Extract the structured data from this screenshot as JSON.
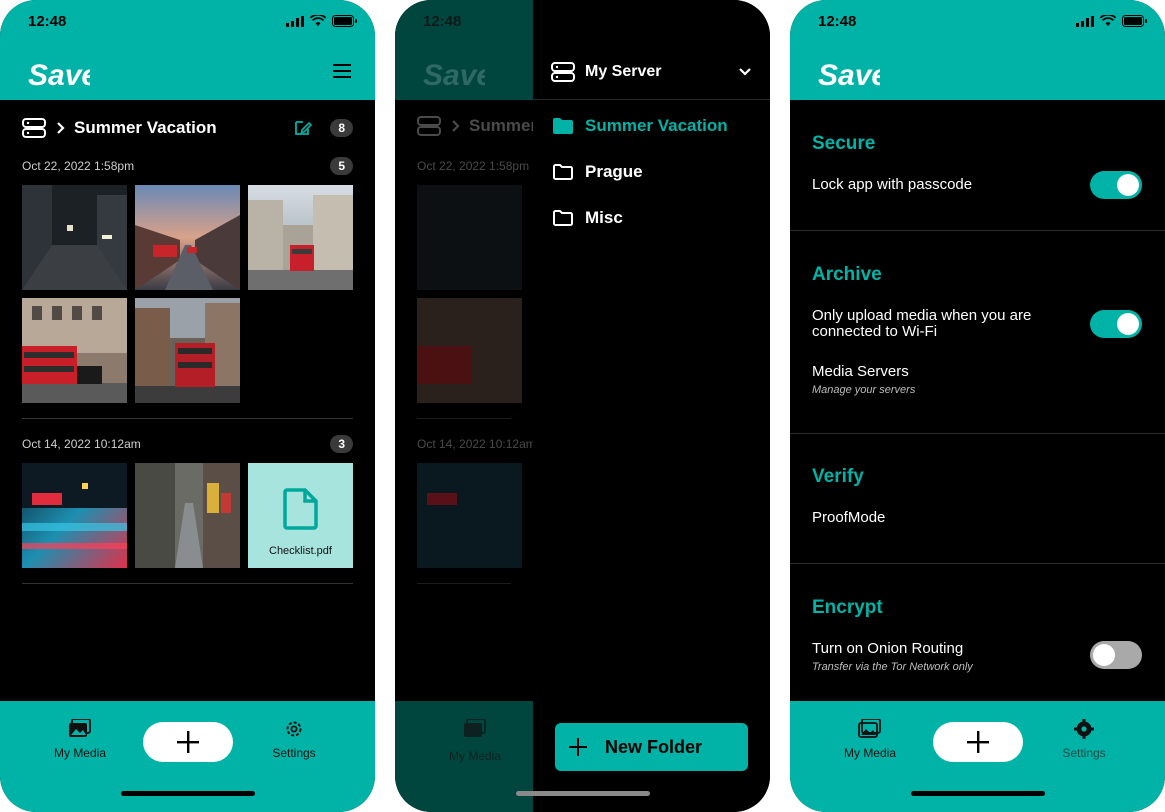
{
  "status": {
    "time": "12:48"
  },
  "brand": {
    "logo_text": "Save"
  },
  "colors": {
    "accent": "#00b3a6",
    "background": "#000000",
    "file_tile": "#a8e4de"
  },
  "media": {
    "breadcrumb_title": "Summer Vacation",
    "total_count": "8",
    "groups": [
      {
        "date": "Oct 22, 2022 1:58pm",
        "count": "5"
      },
      {
        "date": "Oct 14, 2022 10:12am",
        "count": "3"
      }
    ],
    "file_name": "Checklist.pdf"
  },
  "nav": {
    "my_media": "My Media",
    "settings": "Settings"
  },
  "drawer": {
    "server_name": "My Server",
    "folders": [
      "Summer Vacation",
      "Prague",
      "Misc"
    ],
    "new_folder": "New Folder"
  },
  "settings": {
    "secure": {
      "title": "Secure",
      "lock_label": "Lock app with passcode",
      "lock_on": true
    },
    "archive": {
      "title": "Archive",
      "wifi_label_line1": "Only upload media when you are",
      "wifi_label_line2": "connected to Wi-Fi",
      "wifi_on": true,
      "servers_label": "Media Servers",
      "servers_sub": "Manage your servers"
    },
    "verify": {
      "title": "Verify",
      "proofmode_label": "ProofMode"
    },
    "encrypt": {
      "title": "Encrypt",
      "onion_label": "Turn on Onion Routing",
      "onion_sub": "Transfer via the Tor Network only",
      "onion_on": false
    }
  }
}
